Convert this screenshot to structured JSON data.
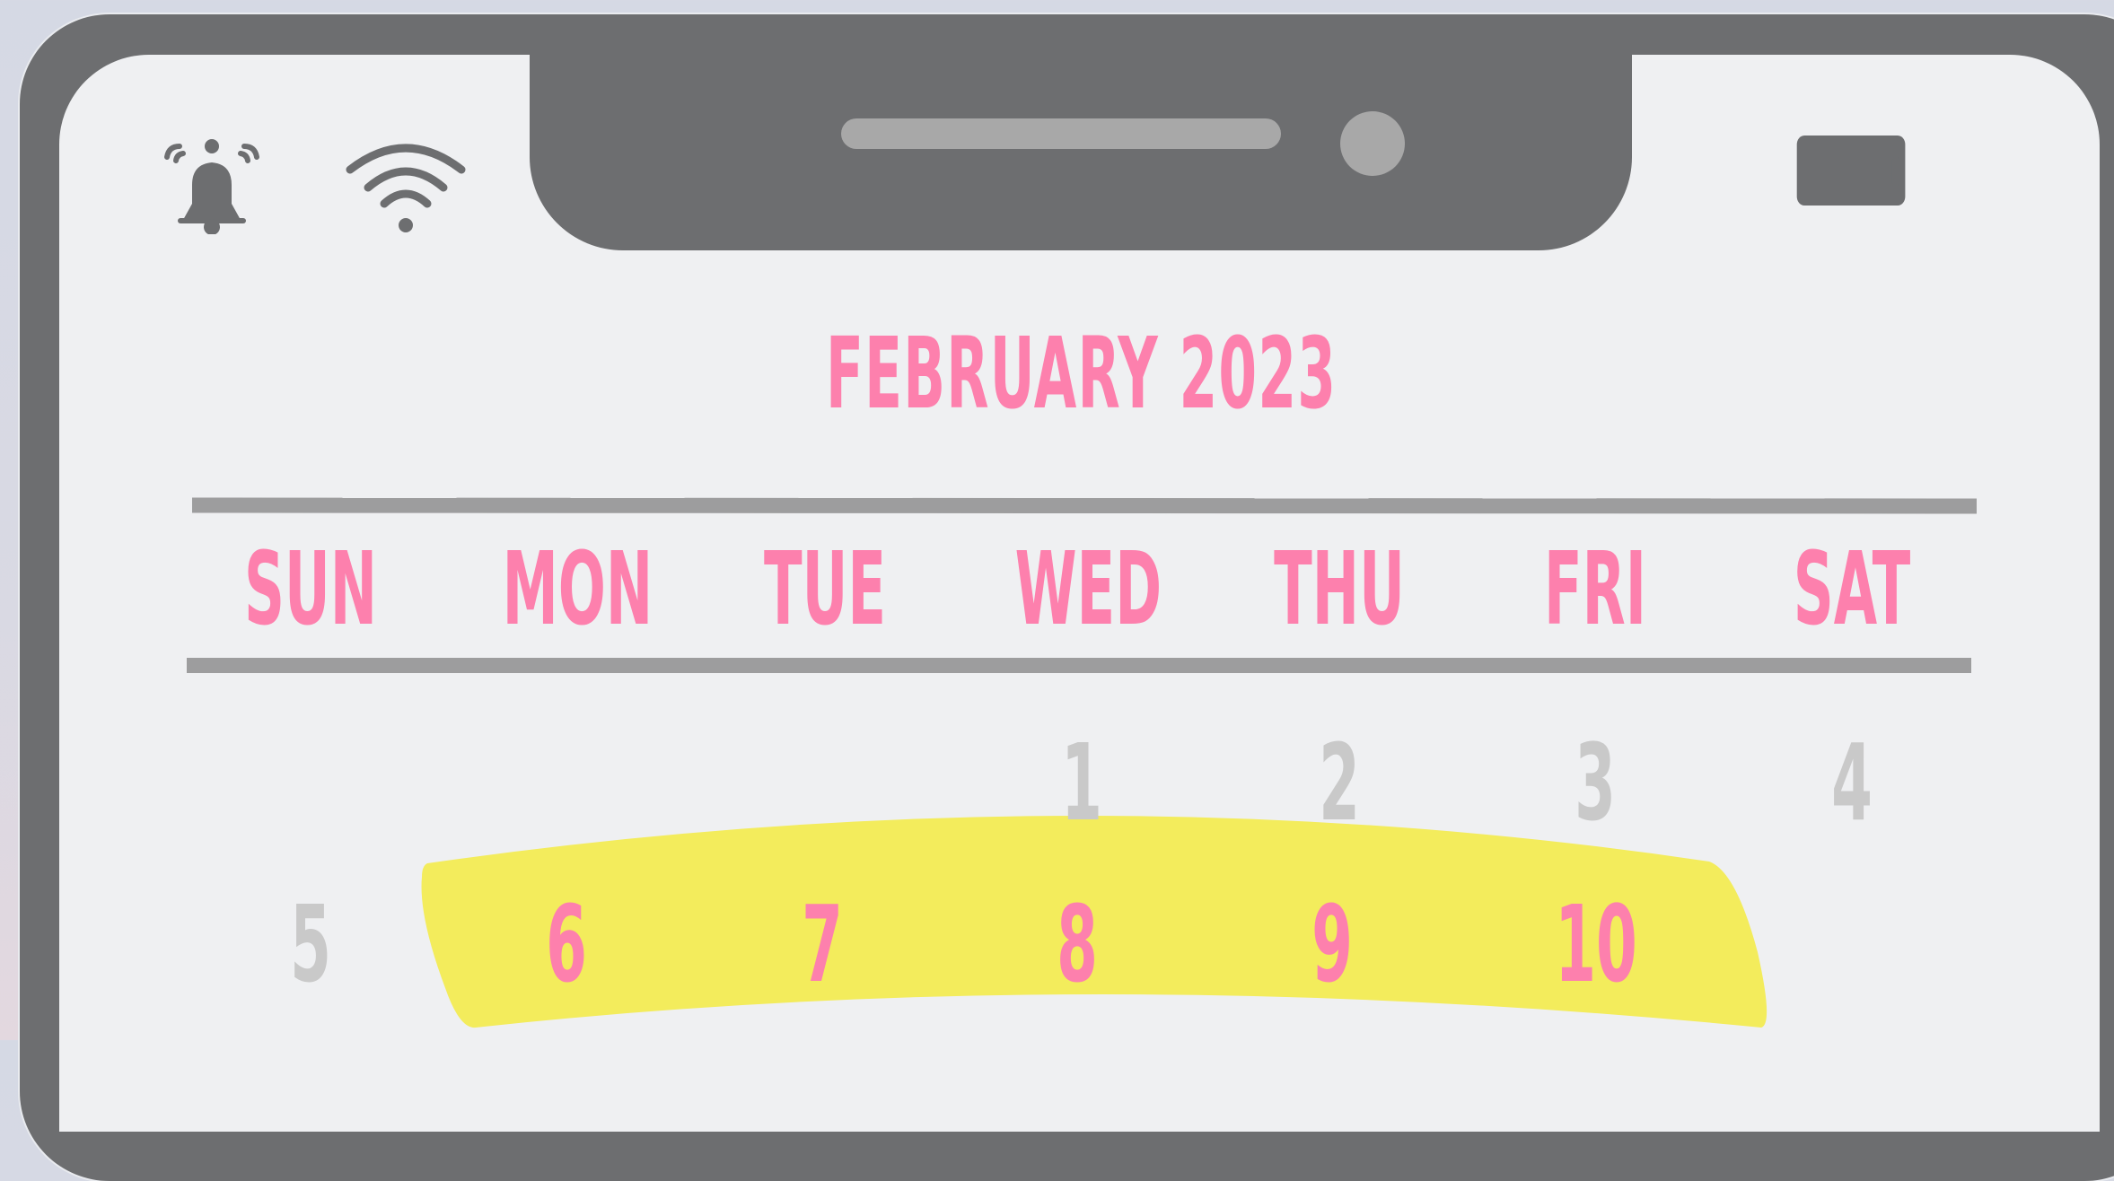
{
  "calendar": {
    "month_title": "FEBRUARY 2023",
    "weekdays": [
      "SUN",
      "MON",
      "TUE",
      "WED",
      "THU",
      "FRI",
      "SAT"
    ],
    "row1": [
      "1",
      "2",
      "3",
      "4"
    ],
    "row2": [
      "5",
      "6",
      "7",
      "8",
      "9",
      "10"
    ]
  },
  "icons": {
    "alarm": "bell-icon",
    "signal": "wifi-icon",
    "power": "battery-icon"
  },
  "colors": {
    "accent_pink": "#fd80ad",
    "highlight_yellow": "#f3ec5c",
    "muted_gray": "#c9c9c9",
    "frame_gray": "#6d6e70",
    "screen_bg": "#eff0f2"
  }
}
